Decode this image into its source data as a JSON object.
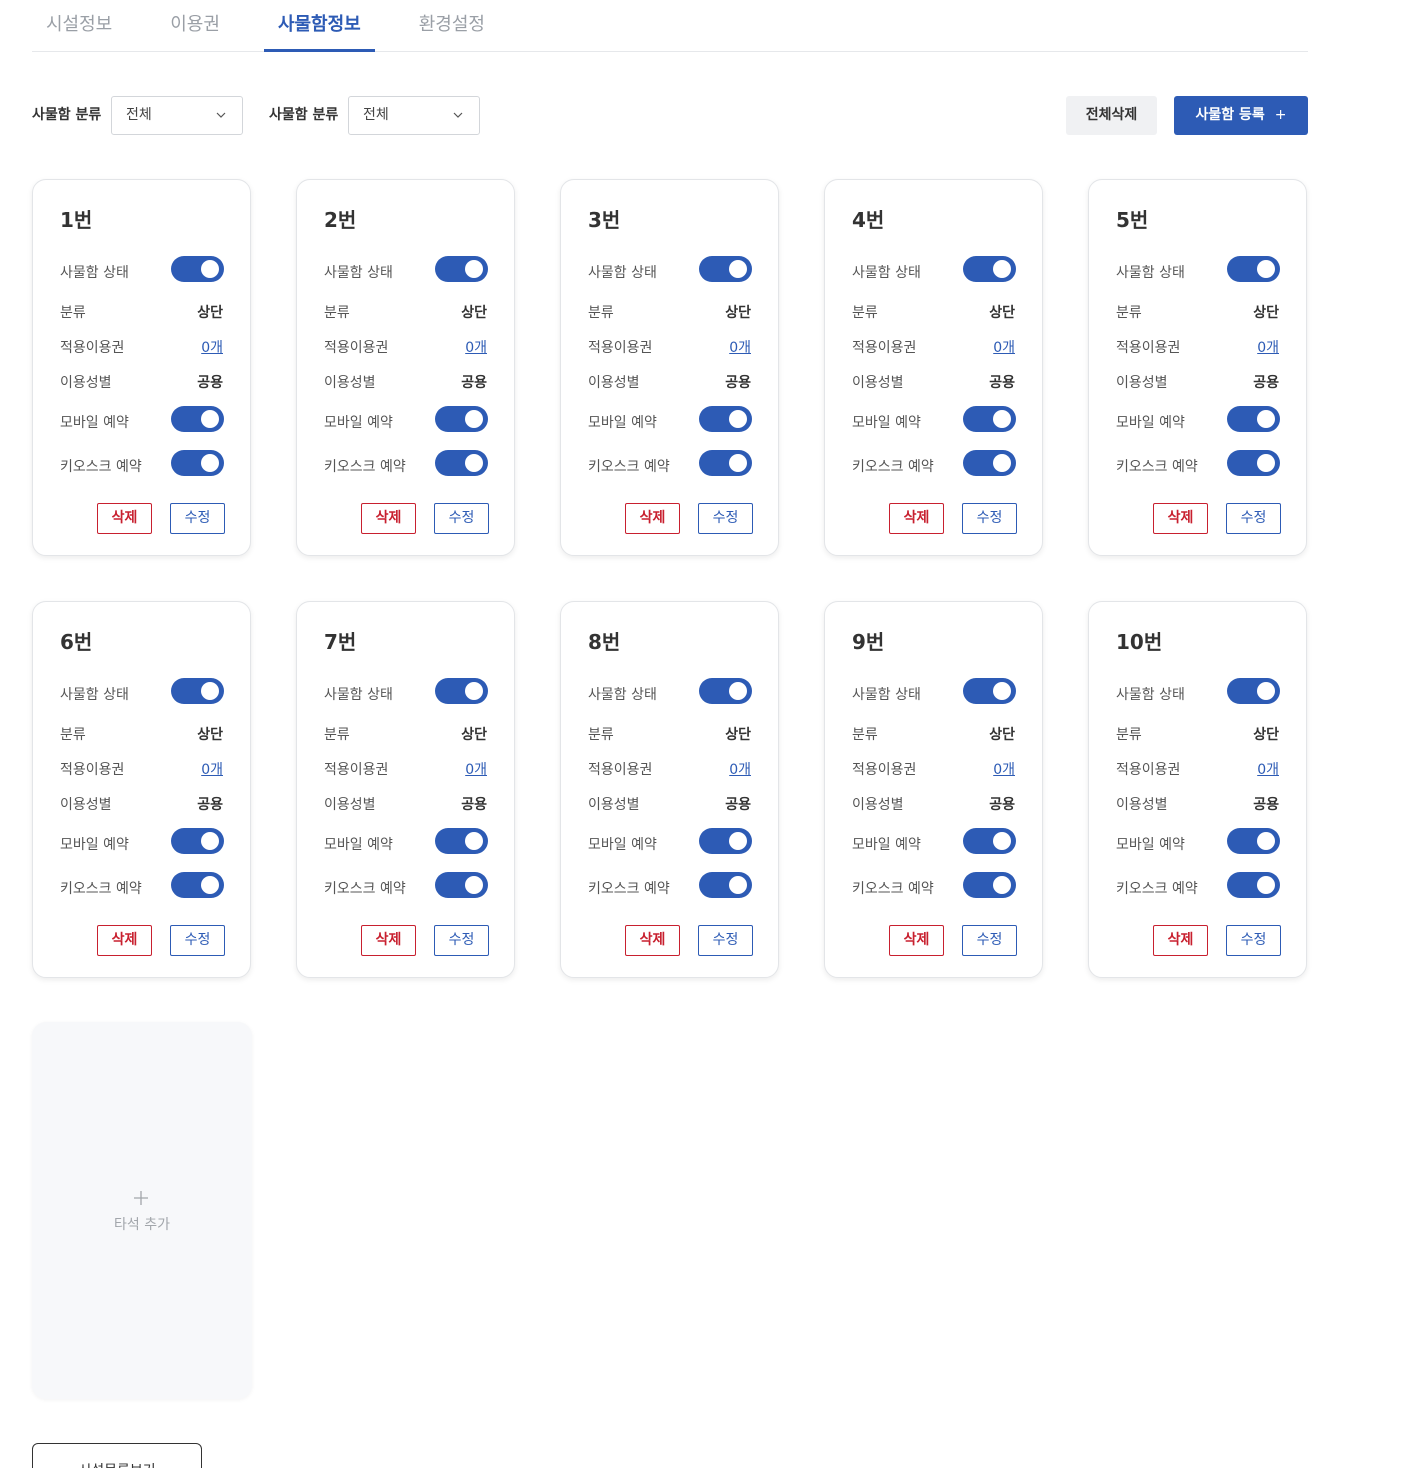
{
  "tabs": [
    {
      "label": "시설정보"
    },
    {
      "label": "이용권"
    },
    {
      "label": "사물함정보"
    },
    {
      "label": "환경설정"
    }
  ],
  "active_tab": "사물함정보",
  "filters": [
    {
      "label": "사물함 분류",
      "selected": "전체"
    },
    {
      "label": "사물함 분류",
      "selected": "전체"
    }
  ],
  "actions": {
    "delete_all_label": "전체삭제",
    "register_label": "사물함 등록",
    "register_icon": "+"
  },
  "field_labels": {
    "status": "사물함 상태",
    "category": "분류",
    "passes": "적용이용권",
    "gender": "이용성별",
    "mobile": "모바일 예약",
    "kiosk": "키오스크 예약"
  },
  "button_labels": {
    "delete": "삭제",
    "edit": "수정"
  },
  "lockers": [
    {
      "title": "1번",
      "status_on": true,
      "category": "상단",
      "passes": "0개",
      "gender": "공용",
      "mobile_on": true,
      "kiosk_on": true
    },
    {
      "title": "2번",
      "status_on": true,
      "category": "상단",
      "passes": "0개",
      "gender": "공용",
      "mobile_on": true,
      "kiosk_on": true
    },
    {
      "title": "3번",
      "status_on": true,
      "category": "상단",
      "passes": "0개",
      "gender": "공용",
      "mobile_on": true,
      "kiosk_on": true
    },
    {
      "title": "4번",
      "status_on": true,
      "category": "상단",
      "passes": "0개",
      "gender": "공용",
      "mobile_on": true,
      "kiosk_on": true
    },
    {
      "title": "5번",
      "status_on": true,
      "category": "상단",
      "passes": "0개",
      "gender": "공용",
      "mobile_on": true,
      "kiosk_on": true
    },
    {
      "title": "6번",
      "status_on": true,
      "category": "상단",
      "passes": "0개",
      "gender": "공용",
      "mobile_on": true,
      "kiosk_on": true
    },
    {
      "title": "7번",
      "status_on": true,
      "category": "상단",
      "passes": "0개",
      "gender": "공용",
      "mobile_on": true,
      "kiosk_on": true
    },
    {
      "title": "8번",
      "status_on": true,
      "category": "상단",
      "passes": "0개",
      "gender": "공용",
      "mobile_on": true,
      "kiosk_on": true
    },
    {
      "title": "9번",
      "status_on": true,
      "category": "상단",
      "passes": "0개",
      "gender": "공용",
      "mobile_on": true,
      "kiosk_on": true
    },
    {
      "title": "10번",
      "status_on": true,
      "category": "상단",
      "passes": "0개",
      "gender": "공용",
      "mobile_on": true,
      "kiosk_on": true
    }
  ],
  "add_card": {
    "icon": "plus-icon",
    "label": "타석 추가"
  },
  "bottom_button": {
    "label": "시설목록보기"
  },
  "colors": {
    "accent": "#2d5bb5",
    "danger": "#c8202f",
    "muted": "#9a9fa6"
  }
}
